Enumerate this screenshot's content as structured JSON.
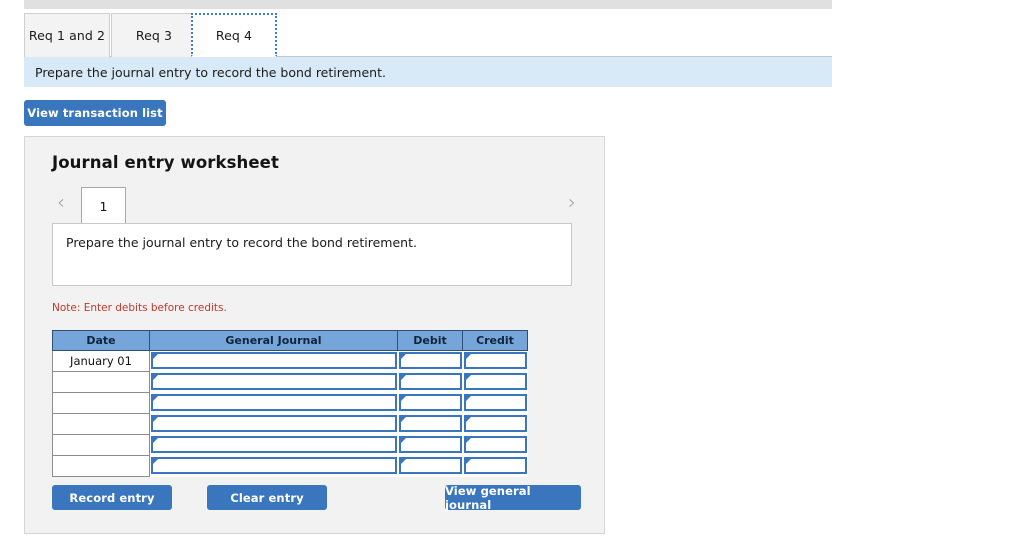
{
  "tabs": [
    {
      "label": "Req 1 and 2",
      "active": false
    },
    {
      "label": "Req 3",
      "active": false
    },
    {
      "label": "Req 4",
      "active": true
    }
  ],
  "instruction": "Prepare the journal entry to record the bond retirement.",
  "toolbar": {
    "view_transaction_list_label": "View transaction list"
  },
  "worksheet": {
    "title": "Journal entry worksheet",
    "pager": {
      "prev_icon": "‹",
      "next_icon": "›",
      "current_page": "1"
    },
    "description": "Prepare the journal entry to record the bond retirement.",
    "note": "Note: Enter debits before credits.",
    "table": {
      "columns": [
        "Date",
        "General Journal",
        "Debit",
        "Credit"
      ],
      "rows": [
        {
          "date": "January 01",
          "general_journal": "",
          "debit": "",
          "credit": ""
        },
        {
          "date": "",
          "general_journal": "",
          "debit": "",
          "credit": ""
        },
        {
          "date": "",
          "general_journal": "",
          "debit": "",
          "credit": ""
        },
        {
          "date": "",
          "general_journal": "",
          "debit": "",
          "credit": ""
        },
        {
          "date": "",
          "general_journal": "",
          "debit": "",
          "credit": ""
        },
        {
          "date": "",
          "general_journal": "",
          "debit": "",
          "credit": ""
        }
      ]
    },
    "buttons": {
      "record_entry": "Record entry",
      "clear_entry": "Clear entry",
      "view_general_journal": "View general journal"
    }
  },
  "colors": {
    "accent_blue": "#3a76bd",
    "table_header_blue": "#76a6d9",
    "instruction_bar_blue": "#d8eaf8",
    "note_red": "#c0392b",
    "panel_gray": "#f2f2f2"
  }
}
